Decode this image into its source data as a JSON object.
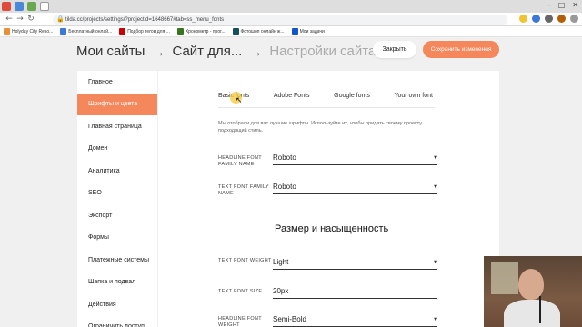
{
  "browser": {
    "url": "tilda.cc/projects/settings/?projectid=1648667#tab=ss_menu_fonts",
    "bookmarks": [
      "Holyday City Reso...",
      "Бесплатный онлай...",
      "Подбор тегов для ...",
      "Хронометр - прог...",
      "Фотошоп онлайн ж...",
      "Мои задачи"
    ]
  },
  "header": {
    "crumbs": [
      "Мои сайты",
      "Сайт для...",
      "Настройки сайта"
    ],
    "arrow": "→",
    "close_label": "Закрыть",
    "save_label": "Сохранить изменения"
  },
  "sidebar": {
    "items": [
      {
        "label": "Главное",
        "active": false
      },
      {
        "label": "Шрифты и цвета",
        "active": true
      },
      {
        "label": "Главная страница",
        "active": false
      },
      {
        "label": "Домен",
        "active": false
      },
      {
        "label": "Аналитика",
        "active": false
      },
      {
        "label": "SEO",
        "active": false
      },
      {
        "label": "Экспорт",
        "active": false
      },
      {
        "label": "Формы",
        "active": false
      },
      {
        "label": "Платежные системы",
        "active": false
      },
      {
        "label": "Шапка и подвал",
        "active": false
      },
      {
        "label": "Действия",
        "active": false
      },
      {
        "label": "Ограничить доступ",
        "active": false
      }
    ]
  },
  "main": {
    "tabs": [
      "Basic fonts",
      "Adobe Fonts",
      "Google fonts",
      "Your own font"
    ],
    "description": "Мы отобрали для вас лучшие шрифты. Используйте их, чтобы придать своему проекту подходящий стиль.",
    "fields": [
      {
        "label": "HEADLINE FONT FAMILY NAME",
        "value": "Roboto"
      },
      {
        "label": "TEXT FONT FAMILY NAME",
        "value": "Roboto"
      }
    ],
    "section_title": "Размер и насыщенность",
    "size_fields": [
      {
        "label": "TEXT FONT WEIGHT",
        "value": "Light"
      },
      {
        "label": "TEXT FONT SIZE",
        "value": "20px"
      },
      {
        "label": "HEADLINE FONT WEIGHT",
        "value": "Semi-Bold"
      }
    ]
  },
  "colors": {
    "accent": "#f4875b",
    "background": "#f0f0f0",
    "panel": "#ffffff"
  }
}
